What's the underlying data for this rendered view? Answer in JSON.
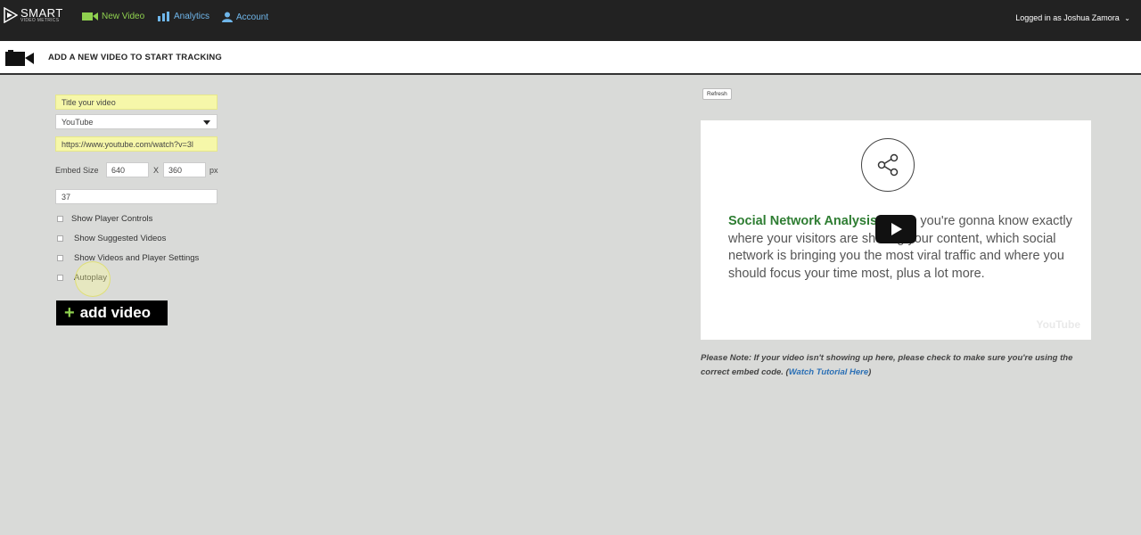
{
  "header": {
    "logo_main": "SMART",
    "logo_sub": "VIDEO METRICS",
    "nav": {
      "new_video": "New Video",
      "analytics": "Analytics",
      "account": "Account"
    },
    "logged_in": "Logged in as Joshua Zamora"
  },
  "subheader": {
    "title": "ADD A NEW VIDEO TO START TRACKING"
  },
  "form": {
    "title_placeholder": "Title your video",
    "source_selected": "YouTube",
    "url_value": "https://www.youtube.com/watch?v=3l",
    "embed_label": "Embed Size",
    "embed_width": "640",
    "embed_x": "X",
    "embed_height": "360",
    "embed_unit": "px",
    "number_value": "37",
    "checkboxes": [
      {
        "label": "Show Player Controls"
      },
      {
        "label": "Show Suggested Videos"
      },
      {
        "label": "Show Videos and Player Settings"
      },
      {
        "label": "Autoplay"
      }
    ],
    "add_button": "add video"
  },
  "preview": {
    "refresh": "Refresh",
    "heading": "Social Network Analysis",
    "body": " - Here you're gonna know exactly where your visitors are sharing your content, which social network is bringing you the most viral traffic and where you should focus your time most, plus a lot more.",
    "watermark": "YouTube",
    "note_text": "Please Note: If your video isn't showing up here, please check to make sure you're using the correct embed code. (",
    "note_link": "Watch Tutorial Here",
    "note_end": ")"
  },
  "colors": {
    "topbar": "#222222",
    "nav_green": "#8fd14f",
    "nav_blue": "#6fb6ea",
    "field_yellow": "#f6f7a9",
    "heading_green": "#2e7d32"
  }
}
